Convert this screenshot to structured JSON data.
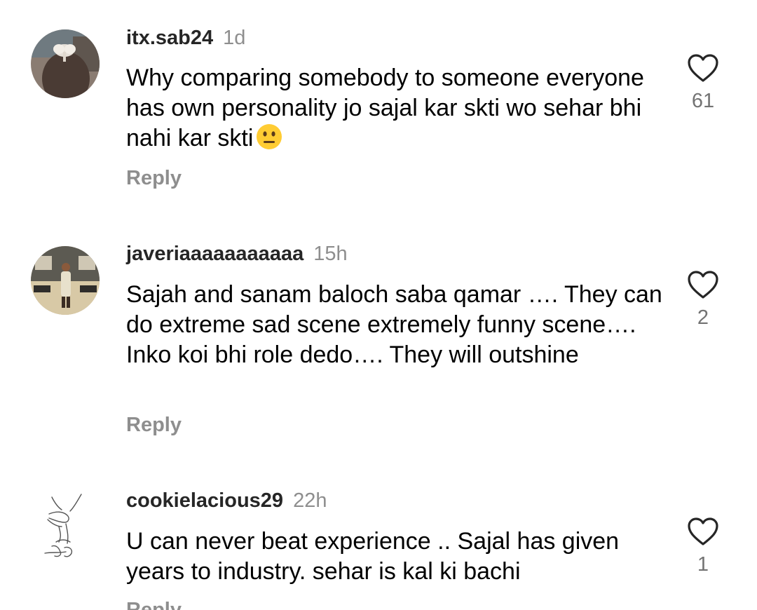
{
  "comments": [
    {
      "username": "itx.sab24",
      "time": "1d",
      "text": "Why comparing somebody to someone everyone has own personality jo sajal kar skti wo sehar bhi nahi kar skti",
      "emoji": "neutral-face",
      "reply_label": "Reply",
      "likes": "61"
    },
    {
      "username": "javeriaaaaaaaaaaa",
      "time": "15h",
      "text": "Sajah and sanam baloch saba qamar …. They can do extreme sad scene extremely funny scene…. Inko koi bhi role dedo…. They will outshine",
      "reply_label": "Reply",
      "likes": "2"
    },
    {
      "username": "cookielacious29",
      "time": "22h",
      "text": "U can never beat experience .. Sajal has given years to industry. sehar is kal ki bachi",
      "reply_label": "Reply",
      "likes": "1"
    }
  ],
  "colors": {
    "username": "#262626",
    "meta": "#8e8e8e",
    "text": "#000000",
    "heart_stroke": "#262626",
    "emoji_fill": "#FFCC33"
  }
}
